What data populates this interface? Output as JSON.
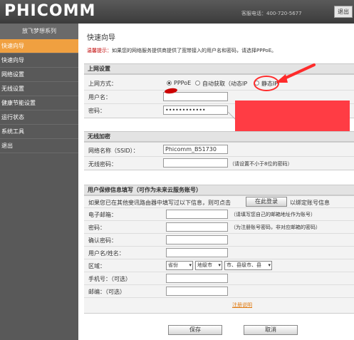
{
  "header": {
    "logo": "PHICOMM",
    "hotline": "客服电话：400-720-5677",
    "top_button": "退出"
  },
  "sidebar": {
    "brand": "放飞梦想系列",
    "items": [
      {
        "label": "快速向导",
        "active": true
      },
      {
        "label": "快速向导"
      },
      {
        "label": "网络设置"
      },
      {
        "label": "无线设置"
      },
      {
        "label": "健康节能设置"
      },
      {
        "label": "运行状态"
      },
      {
        "label": "系统工具"
      },
      {
        "label": "退出"
      }
    ]
  },
  "main": {
    "title": "快速向导",
    "tip_label": "温馨提示：",
    "tip_text": "如果您的网络服务提供商提供了宽带接入的用户名和密码，请选择PPPoE。",
    "internet": {
      "heading": "上网设置",
      "mode_label": "上网方式：",
      "modes": [
        {
          "label": "PPPoE",
          "checked": true
        },
        {
          "label": "自动获取（动态IP"
        },
        {
          "label": "静态IP"
        }
      ],
      "username_label": "用户名：",
      "password_label": "密码：",
      "password_value": "••••••••••••"
    },
    "wireless": {
      "heading": "无线加密",
      "ssid_label": "网络名称（SSID）：",
      "ssid_value": "Phicomm_B51730",
      "key_label": "无线密码：",
      "key_note": "（请设置不小于8位的密码）"
    },
    "account": {
      "heading": "用户保修信息填写（可作为未来云服务账号）",
      "intro": "如果您已在其他斐讯路由器中填写过以下信息，则可点击",
      "online_login_button": "在此登录",
      "intro_suffix": "以绑定账号信息",
      "email_label": "电子邮箱：",
      "email_note": "（请填写您自己的邮箱地址作为账号）",
      "password_label": "密码：",
      "password_note": "（为注册账号密码，非对应邮箱的密码）",
      "confirm_label": "确认密码：",
      "name_label": "用户名/姓名：",
      "region_label": "区域：",
      "province": "省份",
      "city": "地级市",
      "district": "市、县级市、县",
      "phone_label": "手机号：（可选）",
      "postcode_label": "邮编：（可选）",
      "register_link": "注册说明"
    },
    "save_button": "保存",
    "cancel_button": "取消"
  },
  "colors": {
    "header": "#3f3f3f",
    "sidebar": "#595959",
    "active_nav": "#f0a040",
    "annotation_red": "#ff2b2b",
    "tip_red": "#c00000"
  }
}
